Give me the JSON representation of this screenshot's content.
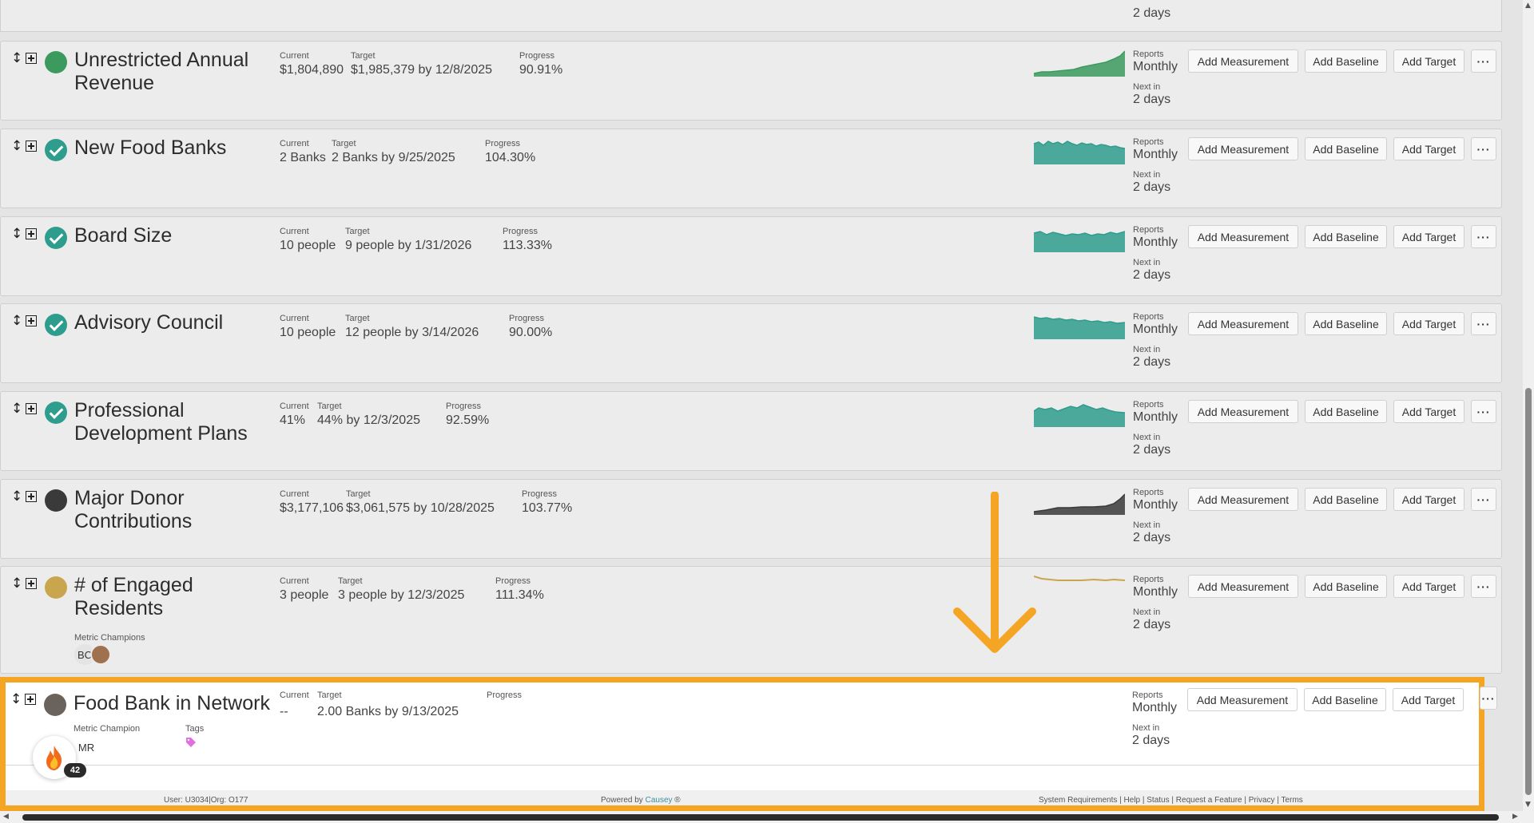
{
  "colors": {
    "green": "#3c9a5f",
    "teal": "#2e9d8d",
    "dark": "#3a3a3a",
    "gold": "#c9a64e",
    "taupe": "#6b625b",
    "highlight": "#f5a524",
    "tag": "#e070e0"
  },
  "top_partial": {
    "next_in_value": "2 days"
  },
  "common": {
    "current_label": "Current",
    "target_label": "Target",
    "progress_label": "Progress",
    "reports_label": "Reports",
    "frequency": "Monthly",
    "next_in_label": "Next in",
    "next_in_value": "2 days",
    "add_measurement": "Add Measurement",
    "add_baseline": "Add Baseline",
    "add_target": "Add Target",
    "more": "···"
  },
  "metrics": [
    {
      "title": "Unrestricted Annual Revenue",
      "status": "circle",
      "status_color": "green",
      "current": "$1,804,890",
      "target": "$1,985,379 by 12/8/2025",
      "progress": "90.91%",
      "spark_color": "green"
    },
    {
      "title": "New Food Banks",
      "status": "check",
      "status_color": "teal",
      "current": "2 Banks",
      "target": "2 Banks by 9/25/2025",
      "progress": "104.30%",
      "spark_color": "teal"
    },
    {
      "title": "Board Size",
      "status": "check",
      "status_color": "teal",
      "current": "10 people",
      "target": "9 people by 1/31/2026",
      "progress": "113.33%",
      "spark_color": "teal"
    },
    {
      "title": "Advisory Council",
      "status": "check",
      "status_color": "teal",
      "current": "10 people",
      "target": "12 people by 3/14/2026",
      "progress": "90.00%",
      "spark_color": "teal"
    },
    {
      "title": "Professional Development Plans",
      "status": "check",
      "status_color": "teal",
      "current": "41%",
      "target": "44% by 12/3/2025",
      "progress": "92.59%",
      "spark_color": "teal"
    },
    {
      "title": "Major Donor Contributions",
      "status": "circle",
      "status_color": "dark",
      "current": "$3,177,106",
      "target": "$3,061,575 by 10/28/2025",
      "progress": "103.77%",
      "spark_color": "dark"
    },
    {
      "title": "# of Engaged Residents",
      "status": "circle",
      "status_color": "gold",
      "current": "3 people",
      "target": "3 people by 12/3/2025",
      "progress": "111.34%",
      "spark_color": "gold",
      "champions_label": "Metric Champions",
      "champions": [
        "BC"
      ]
    }
  ],
  "highlighted": {
    "title": "Food Bank in Network",
    "current": "--",
    "target": "2.00 Banks by 9/13/2025",
    "progress": "",
    "champion_label": "Metric Champion",
    "champion": "MR",
    "tags_label": "Tags",
    "notification_count": "42"
  },
  "footer": {
    "user": "User: U3034|Org: O177",
    "powered_prefix": "Powered by ",
    "powered_brand": "Causey",
    "powered_suffix": " ®",
    "links": [
      "System Requirements",
      "Help",
      "Status",
      "Request a Feature",
      "Privacy",
      "Terms"
    ]
  }
}
